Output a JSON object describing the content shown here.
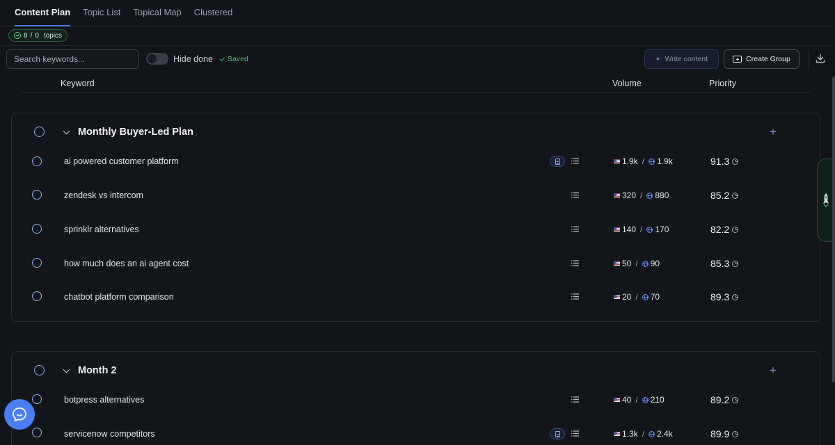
{
  "tabs": [
    {
      "label": "Content Plan",
      "active": true
    },
    {
      "label": "Topic List",
      "active": false
    },
    {
      "label": "Topical Map",
      "active": false
    },
    {
      "label": "Clustered",
      "active": false
    }
  ],
  "topics_badge": {
    "done": "8",
    "sep": "/",
    "total": "0",
    "suffix": "topics"
  },
  "toolbar": {
    "search_placeholder": "Search keywords...",
    "hide_done_label": "Hide done",
    "saved_label": "Saved",
    "write_content_label": "Write content",
    "create_group_label": "Create Group"
  },
  "columns": {
    "keyword": "Keyword",
    "volume": "Volume",
    "priority": "Priority"
  },
  "groups": [
    {
      "title": "Monthly Buyer-Led Plan",
      "rows": [
        {
          "keyword": "ai powered customer platform",
          "us": "1.9k",
          "global": "1.9k",
          "priority": "91.3",
          "has_doc": true
        },
        {
          "keyword": "zendesk vs intercom",
          "us": "320",
          "global": "880",
          "priority": "85.2",
          "has_doc": false
        },
        {
          "keyword": "sprinklr alternatives",
          "us": "140",
          "global": "170",
          "priority": "82.2",
          "has_doc": false
        },
        {
          "keyword": "how much does an ai agent cost",
          "us": "50",
          "global": "90",
          "priority": "85.3",
          "has_doc": false
        },
        {
          "keyword": "chatbot platform comparison",
          "us": "20",
          "global": "70",
          "priority": "89.3",
          "has_doc": false
        }
      ]
    },
    {
      "title": "Month 2",
      "rows": [
        {
          "keyword": "botpress alternatives",
          "us": "40",
          "global": "210",
          "priority": "89.2",
          "has_doc": false
        },
        {
          "keyword": "servicenow competitors",
          "us": "1.3k",
          "global": "2.4k",
          "priority": "89.9",
          "has_doc": true
        }
      ]
    }
  ],
  "colors": {
    "accent": "#4f7df3",
    "success": "#4cc47d",
    "background": "#111419"
  }
}
